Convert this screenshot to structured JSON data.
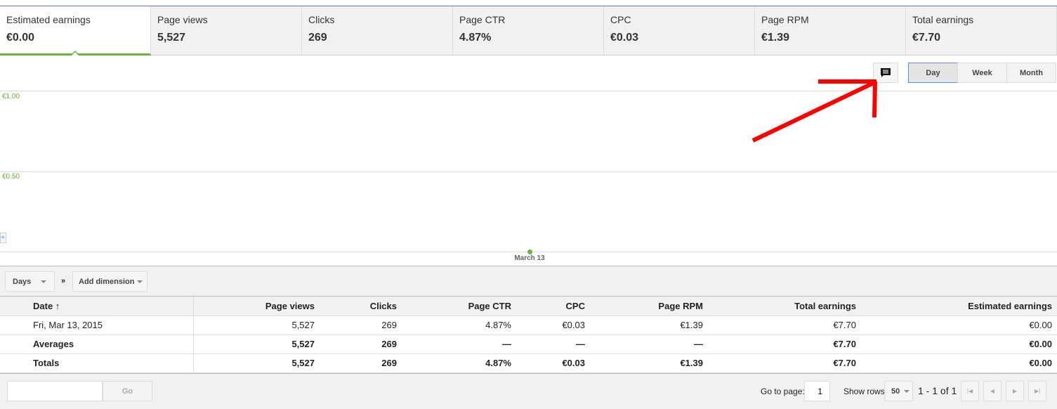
{
  "metrics_tabs": [
    {
      "label": "Estimated earnings",
      "value": "€0.00",
      "active": true
    },
    {
      "label": "Page views",
      "value": "5,527"
    },
    {
      "label": "Clicks",
      "value": "269"
    },
    {
      "label": "Page CTR",
      "value": "4.87%"
    },
    {
      "label": "CPC",
      "value": "€0.03"
    },
    {
      "label": "Page RPM",
      "value": "€1.39"
    },
    {
      "label": "Total earnings",
      "value": "€7.70"
    }
  ],
  "chart_controls": {
    "annotation_icon": "comment-icon",
    "periods": [
      "Day",
      "Week",
      "Month"
    ],
    "selected": "Day"
  },
  "chart_data": {
    "type": "line",
    "x": [
      "March 13"
    ],
    "values": [
      0
    ],
    "y_ticks": [
      "€1.00",
      "€0.50"
    ],
    "ylim": [
      0,
      1.2
    ],
    "grid": true,
    "color": "#6ab43e"
  },
  "toolbar": {
    "dimension": "Days",
    "separator": "»",
    "add_dimension": "Add dimension"
  },
  "table": {
    "headers": [
      "Date ↑",
      "Page views",
      "Clicks",
      "Page CTR",
      "CPC",
      "Page RPM",
      "Total earnings",
      "Estimated earnings"
    ],
    "rows": [
      [
        "Fri, Mar 13, 2015",
        "5,527",
        "269",
        "4.87%",
        "€0.03",
        "€1.39",
        "€7.70",
        "€0.00"
      ],
      [
        "Averages",
        "5,527",
        "269",
        "—",
        "—",
        "—",
        "€7.70",
        "€0.00"
      ],
      [
        "Totals",
        "5,527",
        "269",
        "4.87%",
        "€0.03",
        "€1.39",
        "€7.70",
        "€0.00"
      ]
    ]
  },
  "footer": {
    "go_label": "Go",
    "go_to_page_label": "Go to page:",
    "page": "1",
    "show_rows_label": "Show rows:",
    "rows": "50",
    "range": "1 - 1 of 1"
  },
  "annotation_color": "#ff0000"
}
